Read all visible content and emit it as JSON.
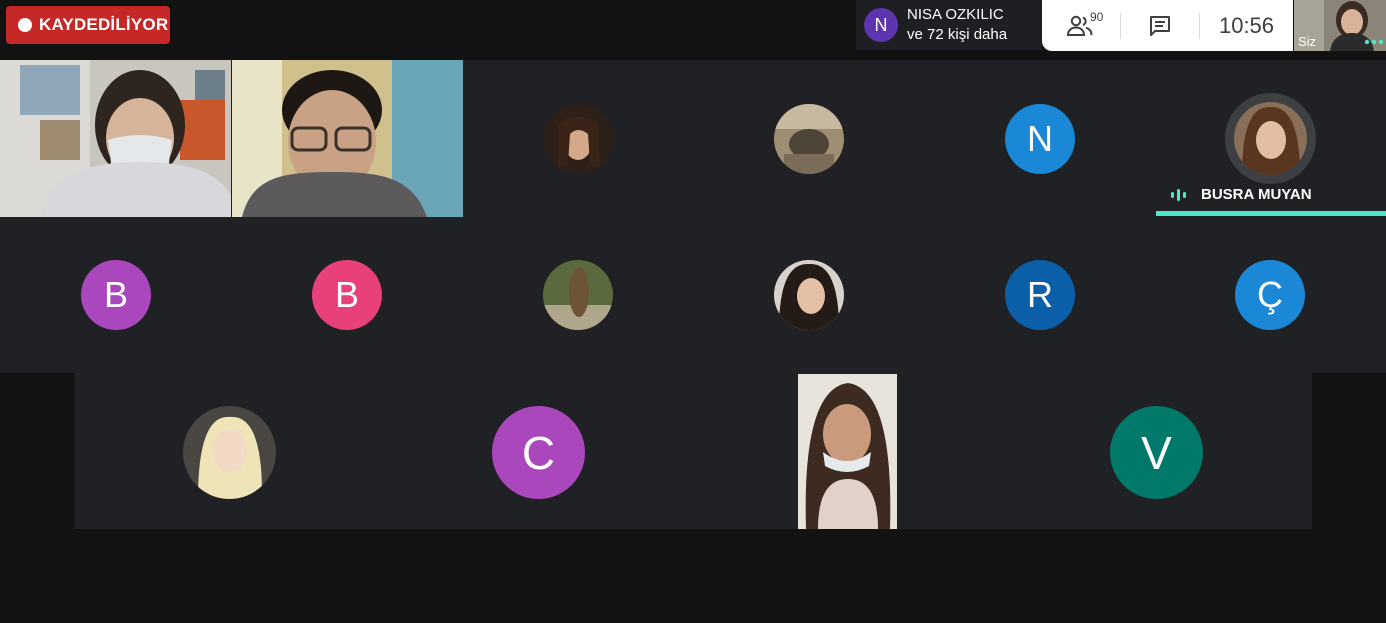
{
  "recording": {
    "label": "KAYDEDİLİYOR"
  },
  "presenter": {
    "initial": "N",
    "name": "NISA OZKILIC",
    "others": "ve 72 kişi daha"
  },
  "toolbar": {
    "people_count": "90",
    "time": "10:56"
  },
  "self_view": {
    "label": "Siz"
  },
  "active_speaker": {
    "name": "BUSRA MUYAN"
  },
  "colors": {
    "record_red": "#c62828",
    "purple": "#ab47bc",
    "pink": "#e8407a",
    "blue_light": "#1a88d6",
    "blue_dark": "#0b5fa8",
    "teal": "#00796b",
    "speaking": "#4de8c8"
  },
  "participants": {
    "row1": [
      {
        "kind": "video",
        "desc": "masked-student"
      },
      {
        "kind": "video",
        "desc": "student-glasses"
      },
      {
        "kind": "photo"
      },
      {
        "kind": "photo"
      },
      {
        "kind": "initial",
        "initial": "N",
        "color": "#1a88d6"
      },
      {
        "kind": "photo",
        "speaking": true
      }
    ],
    "row2": [
      {
        "kind": "initial",
        "initial": "B",
        "color": "#ab47bc"
      },
      {
        "kind": "initial",
        "initial": "B",
        "color": "#e8407a"
      },
      {
        "kind": "photo"
      },
      {
        "kind": "photo"
      },
      {
        "kind": "initial",
        "initial": "R",
        "color": "#0b5fa8"
      },
      {
        "kind": "initial",
        "initial": "Ç",
        "color": "#1a88d6"
      }
    ],
    "row3": [
      {
        "kind": "photo"
      },
      {
        "kind": "initial",
        "initial": "C",
        "color": "#ab47bc"
      },
      {
        "kind": "video",
        "desc": "girl-mask-down"
      },
      {
        "kind": "initial",
        "initial": "V",
        "color": "#00796b"
      }
    ]
  }
}
